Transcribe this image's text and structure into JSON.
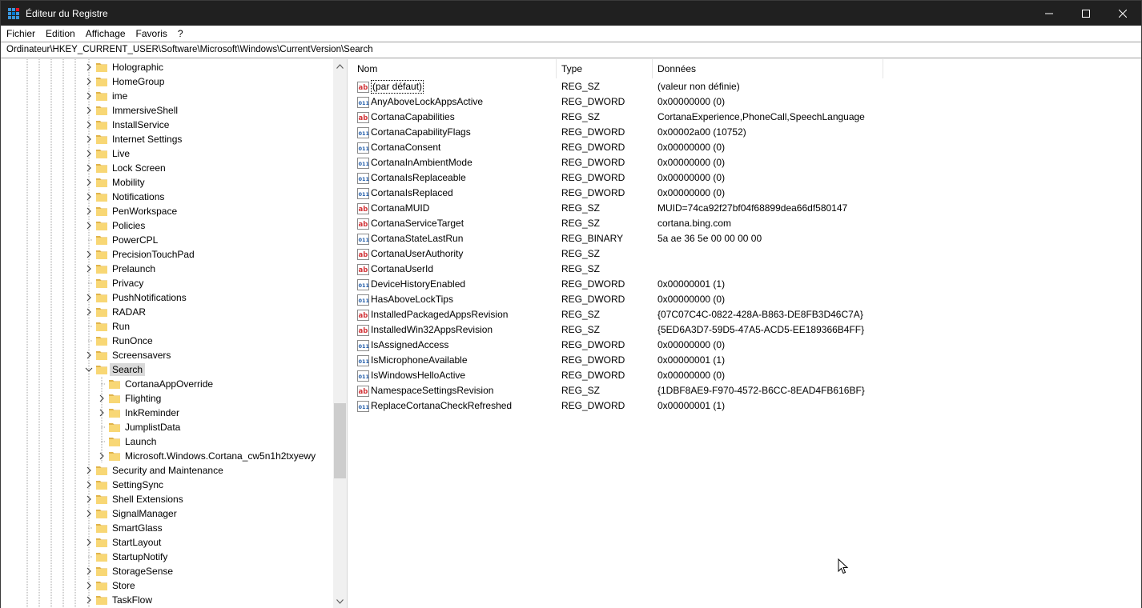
{
  "window": {
    "title": "Éditeur du Registre",
    "icon": "regedit-icon",
    "controls": [
      "minimize-icon",
      "maximize-icon",
      "close-icon"
    ]
  },
  "menu": [
    "Fichier",
    "Edition",
    "Affichage",
    "Favoris",
    "?"
  ],
  "address": "Ordinateur\\HKEY_CURRENT_USER\\Software\\Microsoft\\Windows\\CurrentVersion\\Search",
  "tree": [
    {
      "label": "Holographic",
      "level": 0,
      "expander": "collapsed"
    },
    {
      "label": "HomeGroup",
      "level": 0,
      "expander": "collapsed"
    },
    {
      "label": "ime",
      "level": 0,
      "expander": "collapsed"
    },
    {
      "label": "ImmersiveShell",
      "level": 0,
      "expander": "collapsed"
    },
    {
      "label": "InstallService",
      "level": 0,
      "expander": "collapsed"
    },
    {
      "label": "Internet Settings",
      "level": 0,
      "expander": "collapsed"
    },
    {
      "label": "Live",
      "level": 0,
      "expander": "collapsed"
    },
    {
      "label": "Lock Screen",
      "level": 0,
      "expander": "collapsed"
    },
    {
      "label": "Mobility",
      "level": 0,
      "expander": "collapsed"
    },
    {
      "label": "Notifications",
      "level": 0,
      "expander": "collapsed"
    },
    {
      "label": "PenWorkspace",
      "level": 0,
      "expander": "collapsed"
    },
    {
      "label": "Policies",
      "level": 0,
      "expander": "collapsed"
    },
    {
      "label": "PowerCPL",
      "level": 0,
      "expander": "none"
    },
    {
      "label": "PrecisionTouchPad",
      "level": 0,
      "expander": "collapsed"
    },
    {
      "label": "Prelaunch",
      "level": 0,
      "expander": "collapsed"
    },
    {
      "label": "Privacy",
      "level": 0,
      "expander": "none"
    },
    {
      "label": "PushNotifications",
      "level": 0,
      "expander": "collapsed"
    },
    {
      "label": "RADAR",
      "level": 0,
      "expander": "collapsed"
    },
    {
      "label": "Run",
      "level": 0,
      "expander": "none"
    },
    {
      "label": "RunOnce",
      "level": 0,
      "expander": "none"
    },
    {
      "label": "Screensavers",
      "level": 0,
      "expander": "collapsed"
    },
    {
      "label": "Search",
      "level": 0,
      "expander": "expanded",
      "selected": true
    },
    {
      "label": "CortanaAppOverride",
      "level": 1,
      "expander": "none"
    },
    {
      "label": "Flighting",
      "level": 1,
      "expander": "collapsed"
    },
    {
      "label": "InkReminder",
      "level": 1,
      "expander": "collapsed"
    },
    {
      "label": "JumplistData",
      "level": 1,
      "expander": "none"
    },
    {
      "label": "Launch",
      "level": 1,
      "expander": "none"
    },
    {
      "label": "Microsoft.Windows.Cortana_cw5n1h2txyewy",
      "level": 1,
      "expander": "collapsed"
    },
    {
      "label": "Security and Maintenance",
      "level": 0,
      "expander": "collapsed"
    },
    {
      "label": "SettingSync",
      "level": 0,
      "expander": "collapsed"
    },
    {
      "label": "Shell Extensions",
      "level": 0,
      "expander": "collapsed"
    },
    {
      "label": "SignalManager",
      "level": 0,
      "expander": "collapsed"
    },
    {
      "label": "SmartGlass",
      "level": 0,
      "expander": "none"
    },
    {
      "label": "StartLayout",
      "level": 0,
      "expander": "collapsed"
    },
    {
      "label": "StartupNotify",
      "level": 0,
      "expander": "none"
    },
    {
      "label": "StorageSense",
      "level": 0,
      "expander": "collapsed"
    },
    {
      "label": "Store",
      "level": 0,
      "expander": "collapsed"
    },
    {
      "label": "TaskFlow",
      "level": 0,
      "expander": "collapsed"
    }
  ],
  "columns": {
    "name": "Nom",
    "type": "Type",
    "data": "Données"
  },
  "values": [
    {
      "name": "(par défaut)",
      "type": "REG_SZ",
      "data": "(valeur non définie)",
      "icon": "string"
    },
    {
      "name": "AnyAboveLockAppsActive",
      "type": "REG_DWORD",
      "data": "0x00000000 (0)",
      "icon": "binary"
    },
    {
      "name": "CortanaCapabilities",
      "type": "REG_SZ",
      "data": "CortanaExperience,PhoneCall,SpeechLanguage",
      "icon": "string"
    },
    {
      "name": "CortanaCapabilityFlags",
      "type": "REG_DWORD",
      "data": "0x00002a00 (10752)",
      "icon": "binary"
    },
    {
      "name": "CortanaConsent",
      "type": "REG_DWORD",
      "data": "0x00000000 (0)",
      "icon": "binary"
    },
    {
      "name": "CortanaInAmbientMode",
      "type": "REG_DWORD",
      "data": "0x00000000 (0)",
      "icon": "binary"
    },
    {
      "name": "CortanaIsReplaceable",
      "type": "REG_DWORD",
      "data": "0x00000000 (0)",
      "icon": "binary"
    },
    {
      "name": "CortanaIsReplaced",
      "type": "REG_DWORD",
      "data": "0x00000000 (0)",
      "icon": "binary"
    },
    {
      "name": "CortanaMUID",
      "type": "REG_SZ",
      "data": "MUID=74ca92f27bf04f68899dea66df580147",
      "icon": "string"
    },
    {
      "name": "CortanaServiceTarget",
      "type": "REG_SZ",
      "data": "cortana.bing.com",
      "icon": "string"
    },
    {
      "name": "CortanaStateLastRun",
      "type": "REG_BINARY",
      "data": "5a ae 36 5e 00 00 00 00",
      "icon": "binary"
    },
    {
      "name": "CortanaUserAuthority",
      "type": "REG_SZ",
      "data": "",
      "icon": "string"
    },
    {
      "name": "CortanaUserId",
      "type": "REG_SZ",
      "data": "",
      "icon": "string"
    },
    {
      "name": "DeviceHistoryEnabled",
      "type": "REG_DWORD",
      "data": "0x00000001 (1)",
      "icon": "binary"
    },
    {
      "name": "HasAboveLockTips",
      "type": "REG_DWORD",
      "data": "0x00000000 (0)",
      "icon": "binary"
    },
    {
      "name": "InstalledPackagedAppsRevision",
      "type": "REG_SZ",
      "data": "{07C07C4C-0822-428A-B863-DE8FB3D46C7A}",
      "icon": "string"
    },
    {
      "name": "InstalledWin32AppsRevision",
      "type": "REG_SZ",
      "data": "{5ED6A3D7-59D5-47A5-ACD5-EE189366B4FF}",
      "icon": "string"
    },
    {
      "name": "IsAssignedAccess",
      "type": "REG_DWORD",
      "data": "0x00000000 (0)",
      "icon": "binary"
    },
    {
      "name": "IsMicrophoneAvailable",
      "type": "REG_DWORD",
      "data": "0x00000001 (1)",
      "icon": "binary"
    },
    {
      "name": "IsWindowsHelloActive",
      "type": "REG_DWORD",
      "data": "0x00000000 (0)",
      "icon": "binary"
    },
    {
      "name": "NamespaceSettingsRevision",
      "type": "REG_SZ",
      "data": "{1DBF8AE9-F970-4572-B6CC-8EAD4FB616BF}",
      "icon": "string"
    },
    {
      "name": "ReplaceCortanaCheckRefreshed",
      "type": "REG_DWORD",
      "data": "0x00000001 (1)",
      "icon": "binary"
    }
  ],
  "colors": {
    "titlebar": "#202020",
    "folder": "#f8d775",
    "folder_dark": "#e0b34a",
    "string_icon": "#d13438",
    "binary_icon": "#1e5aa8",
    "selected": "#d9d9d9"
  }
}
